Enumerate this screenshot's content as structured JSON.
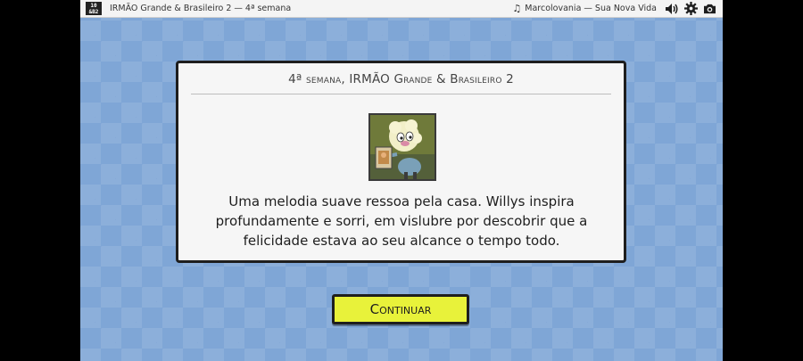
{
  "topbar": {
    "logo_text_top": "10",
    "logo_text_bottom": "&B2",
    "game_title": "IRMÃO Grande & Brasileiro 2 — 4ª semana",
    "music_title": "Marcolovania — Sua Nova Vida",
    "icons": [
      "music-note-icon",
      "volume-icon",
      "gear-icon",
      "camera-icon"
    ]
  },
  "dialog": {
    "title": "4ª semana, IRMÃO Grande & Brasileiro 2",
    "text": "Uma melodia suave ressoa pela casa. Willys inspira profundamente e sorri, em vislubre por descobrir que a felicidade estava ao seu alcance o tempo todo."
  },
  "continue_button": {
    "label": "Continuar"
  },
  "colors": {
    "background": "#7fa6d6",
    "button": "#e8f23a",
    "dialog": "#f6f6f6",
    "border": "#1e1e1e"
  }
}
